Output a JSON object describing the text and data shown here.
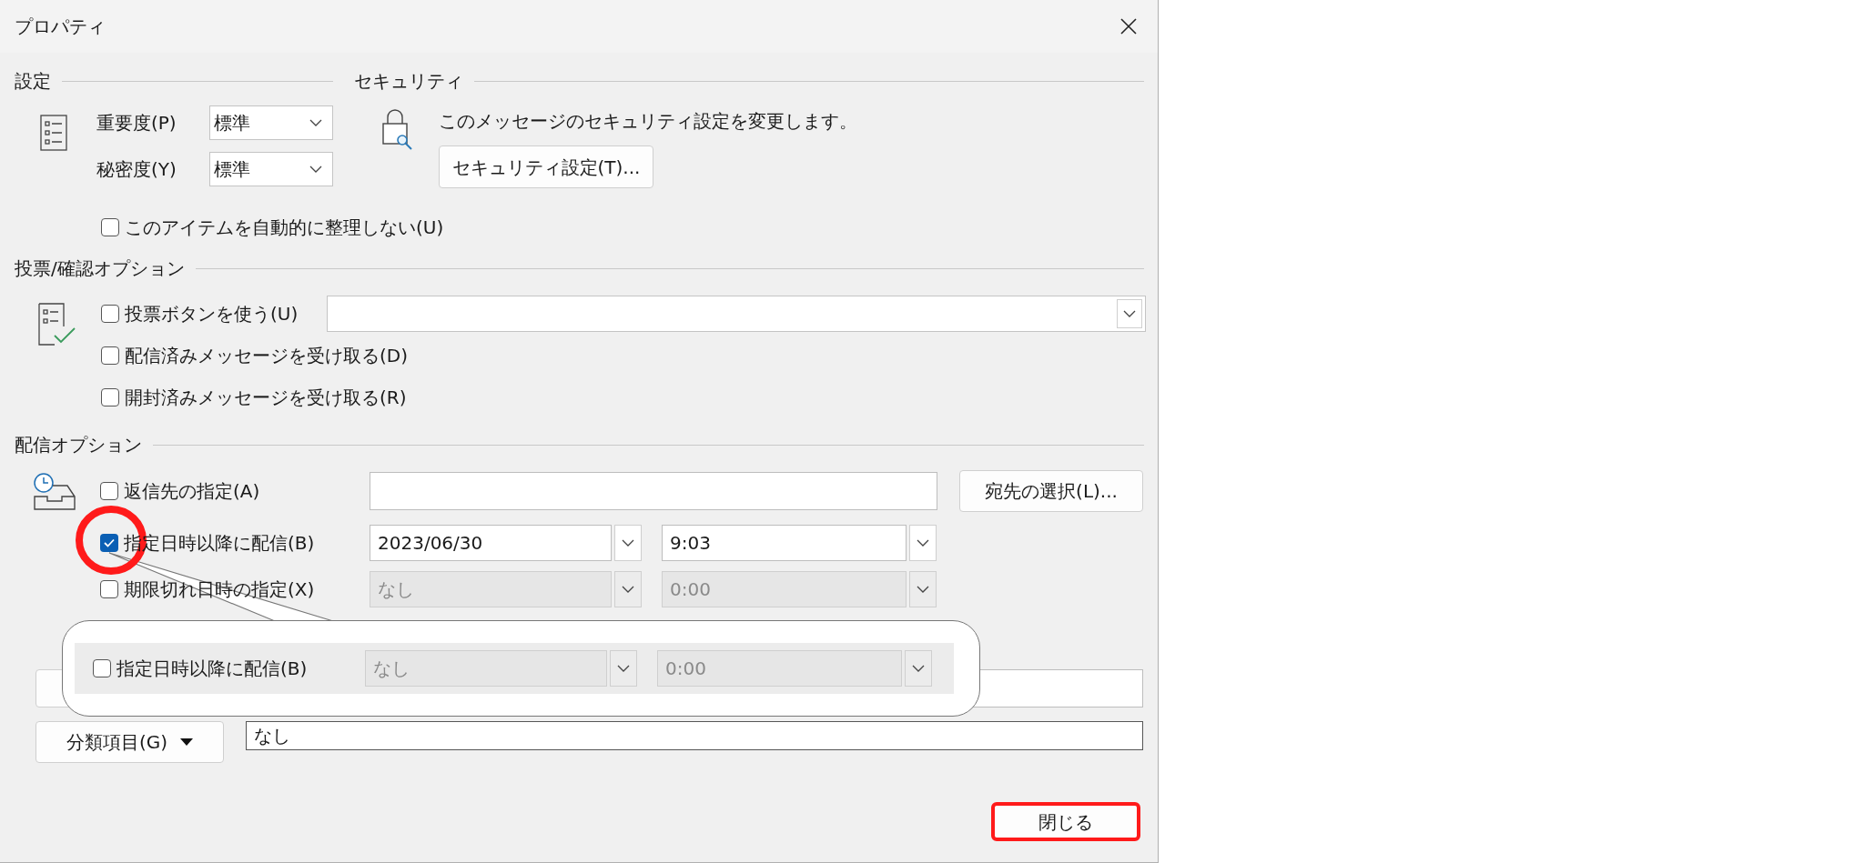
{
  "window": {
    "title": "プロパティ"
  },
  "settings": {
    "heading": "設定",
    "fields": [
      {
        "label": "重要度(P)",
        "value": "標準"
      },
      {
        "label": "秘密度(Y)",
        "value": "標準"
      }
    ],
    "no_auto_archive": {
      "label": "このアイテムを自動的に整理しない(U)",
      "checked": false
    }
  },
  "security": {
    "heading": "セキュリティ",
    "description": "このメッセージのセキュリティ設定を変更します。",
    "button": "セキュリティ設定(T)..."
  },
  "voting": {
    "heading": "投票/確認オプション",
    "options": [
      {
        "label": "投票ボタンを使う(U)",
        "checked": false,
        "kind": "combo"
      },
      {
        "label": "配信済みメッセージを受け取る(D)",
        "checked": false,
        "kind": "plain"
      },
      {
        "label": "開封済みメッセージを受け取る(R)",
        "checked": false,
        "kind": "plain"
      }
    ]
  },
  "delivery": {
    "heading": "配信オプション",
    "reply_to": {
      "label": "返信先の指定(A)",
      "checked": false,
      "button": "宛先の選択(L)..."
    },
    "schedule": [
      {
        "label": "指定日時以降に配信(B)",
        "checked": true,
        "disabled": false,
        "date": "2023/06/30",
        "time": "9:03"
      },
      {
        "label": "期限切れ日時の指定(X)",
        "checked": false,
        "disabled": true,
        "date": "なし",
        "time": "0:00"
      }
    ]
  },
  "categories": {
    "button": "分類項目(G)",
    "value": "なし"
  },
  "close_button": "閉じる",
  "callout": {
    "label": "指定日時以降に配信(B)",
    "checked": false,
    "disabled": true,
    "date": "なし",
    "time": "0:00"
  }
}
